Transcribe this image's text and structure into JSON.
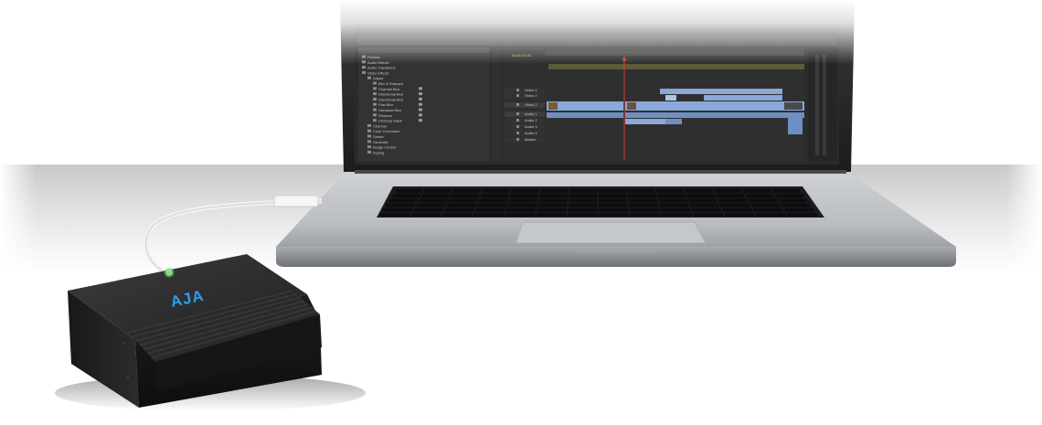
{
  "scene": {
    "description_free": true,
    "device": {
      "logo_text": "AJA",
      "status_light_color": "#7be07b",
      "logo_color": "#2fa0e6"
    },
    "laptop": {
      "screen": {
        "bins": [
          "Presets",
          "Audio Effects",
          "Audio Transitions",
          "Video Effects",
          "Adjust",
          "Blur & Sharpen",
          "Channel Blur",
          "Directional Blur",
          "Directional Blur",
          "Fast Blur",
          "Gaussian Blur",
          "Sharpen",
          "Unsharp Mask",
          "Channel",
          "Color Correction",
          "Distort",
          "Generate",
          "Image Control",
          "Keying"
        ],
        "tracks": [
          "Video 3",
          "Video 2",
          "Video 1",
          "Audio 1",
          "Audio 2",
          "Audio 3",
          "Audio 4",
          "Master"
        ]
      }
    },
    "colors": {
      "app_background": "#2b2b2b",
      "clip_video": "#8aa8d8",
      "clip_audio": "#6f8fc4",
      "playhead": "#d23c3c"
    }
  }
}
